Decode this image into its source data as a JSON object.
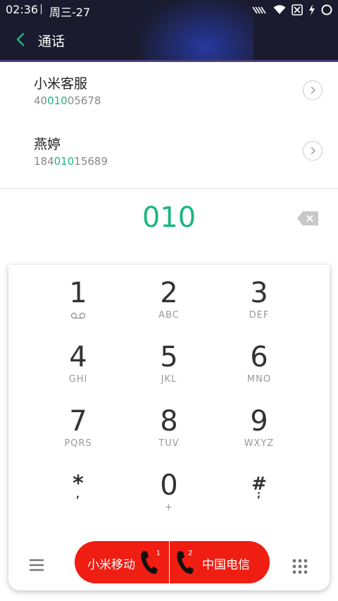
{
  "status": {
    "time": "02:36",
    "date": "周三-27"
  },
  "appbar": {
    "title": "通话"
  },
  "results": [
    {
      "name": "小米客服",
      "num_prefix": "40",
      "num_match": "010",
      "num_suffix": "05678"
    },
    {
      "name": "燕婷",
      "num_prefix": "184",
      "num_match": "010",
      "num_suffix": "15689"
    }
  ],
  "dial": {
    "typed": "010"
  },
  "keypad": [
    {
      "digit": "1",
      "letters": ""
    },
    {
      "digit": "2",
      "letters": "ABC"
    },
    {
      "digit": "3",
      "letters": "DEF"
    },
    {
      "digit": "4",
      "letters": "GHI"
    },
    {
      "digit": "5",
      "letters": "JKL"
    },
    {
      "digit": "6",
      "letters": "MNO"
    },
    {
      "digit": "7",
      "letters": "PQRS"
    },
    {
      "digit": "8",
      "letters": "TUV"
    },
    {
      "digit": "9",
      "letters": "WXYZ"
    },
    {
      "digit": "*",
      "letters": ","
    },
    {
      "digit": "0",
      "letters": "+"
    },
    {
      "digit": "#",
      "letters": ";"
    }
  ],
  "call": {
    "sim1_label": "小米移动",
    "sim1_num": "1",
    "sim2_label": "中国电信",
    "sim2_num": "2"
  },
  "colors": {
    "accent": "#1bb67f",
    "call": "#f01d12",
    "header": "#1a1b2e"
  }
}
